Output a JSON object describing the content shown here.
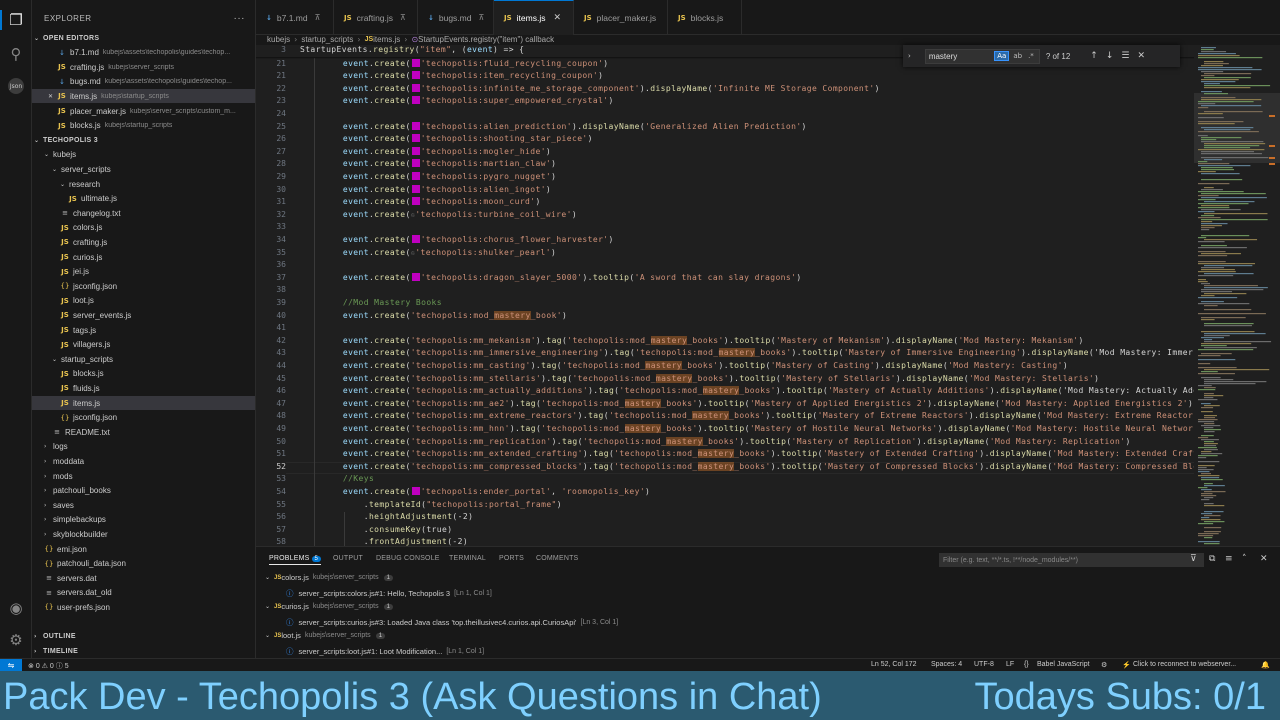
{
  "sidebar": {
    "title": "EXPLORER",
    "more": "···",
    "open_editors_label": "OPEN EDITORS",
    "open_editors": [
      {
        "icon": "md",
        "name": "b7.1.md",
        "path": "kubejs\\assets\\techopolis\\guides\\techop..."
      },
      {
        "icon": "js",
        "name": "crafting.js",
        "path": "kubejs\\server_scripts"
      },
      {
        "icon": "md",
        "name": "bugs.md",
        "path": "kubejs\\assets\\techopolis\\guides\\techop..."
      },
      {
        "icon": "js",
        "name": "items.js",
        "path": "kubejs\\startup_scripts"
      },
      {
        "icon": "js",
        "name": "placer_maker.js",
        "path": "kubejs\\server_scripts\\custom_m..."
      },
      {
        "icon": "js",
        "name": "blocks.js",
        "path": "kubejs\\startup_scripts"
      }
    ],
    "project_label": "TECHOPOLIS 3",
    "tree": [
      {
        "name": "kubejs",
        "kind": "folder-open",
        "indent": 1
      },
      {
        "name": "server_scripts",
        "kind": "folder-open",
        "indent": 2
      },
      {
        "name": "research",
        "kind": "folder-open",
        "indent": 3
      },
      {
        "name": "ultimate.js",
        "kind": "js",
        "indent": 4
      },
      {
        "name": "changelog.txt",
        "kind": "txt",
        "indent": 3
      },
      {
        "name": "colors.js",
        "kind": "js",
        "indent": 3
      },
      {
        "name": "crafting.js",
        "kind": "js",
        "indent": 3
      },
      {
        "name": "curios.js",
        "kind": "js",
        "indent": 3
      },
      {
        "name": "jei.js",
        "kind": "js",
        "indent": 3
      },
      {
        "name": "jsconfig.json",
        "kind": "json",
        "indent": 3
      },
      {
        "name": "loot.js",
        "kind": "js",
        "indent": 3
      },
      {
        "name": "server_events.js",
        "kind": "js",
        "indent": 3
      },
      {
        "name": "tags.js",
        "kind": "js",
        "indent": 3
      },
      {
        "name": "villagers.js",
        "kind": "js",
        "indent": 3
      },
      {
        "name": "startup_scripts",
        "kind": "folder-open",
        "indent": 2
      },
      {
        "name": "blocks.js",
        "kind": "js",
        "indent": 3
      },
      {
        "name": "fluids.js",
        "kind": "js",
        "indent": 3
      },
      {
        "name": "items.js",
        "kind": "js",
        "indent": 3
      },
      {
        "name": "jsconfig.json",
        "kind": "json",
        "indent": 3
      },
      {
        "name": "README.txt",
        "kind": "txt",
        "indent": 2
      },
      {
        "name": "logs",
        "kind": "folder",
        "indent": 1
      },
      {
        "name": "moddata",
        "kind": "folder",
        "indent": 1
      },
      {
        "name": "mods",
        "kind": "folder",
        "indent": 1
      },
      {
        "name": "patchouli_books",
        "kind": "folder",
        "indent": 1
      },
      {
        "name": "saves",
        "kind": "folder",
        "indent": 1
      },
      {
        "name": "simplebackups",
        "kind": "folder",
        "indent": 1
      },
      {
        "name": "skyblockbuilder",
        "kind": "folder",
        "indent": 1
      },
      {
        "name": "emi.json",
        "kind": "json",
        "indent": 1
      },
      {
        "name": "patchouli_data.json",
        "kind": "json",
        "indent": 1
      },
      {
        "name": "servers.dat",
        "kind": "dat",
        "indent": 1
      },
      {
        "name": "servers.dat_old",
        "kind": "dat",
        "indent": 1
      },
      {
        "name": "user-prefs.json",
        "kind": "json",
        "indent": 1
      }
    ],
    "outline_label": "OUTLINE",
    "timeline_label": "TIMELINE"
  },
  "tabs": [
    {
      "icon": "md",
      "label": "b7.1.md",
      "pin": true
    },
    {
      "icon": "js",
      "label": "crafting.js",
      "pin": true
    },
    {
      "icon": "md",
      "label": "bugs.md",
      "pin": true
    },
    {
      "icon": "js",
      "label": "items.js",
      "close": true,
      "active": true
    },
    {
      "icon": "js",
      "label": "placer_maker.js"
    },
    {
      "icon": "js",
      "label": "blocks.js"
    }
  ],
  "breadcrumb": [
    "kubejs",
    "startup_scripts",
    "items.js",
    "StartupEvents.registry(\"item\") callback"
  ],
  "find": {
    "query": "mastery",
    "opt_case": "Aa",
    "opt_word": "ab",
    "opt_regex": ".*",
    "count": "? of 12"
  },
  "editor": {
    "current_line": "52",
    "lines": [
      {
        "n": "3",
        "t": "StartupEvents.registry(\"item\", (event) => {",
        "k": "sticky"
      },
      {
        "n": "21",
        "t": "    event.create(  'techopolis:fluid_recycling_coupon')",
        "k": "sw"
      },
      {
        "n": "21",
        "t": "    event.create(  'techopolis:item_recycling_coupon')",
        "k": "sw"
      },
      {
        "n": "22",
        "t": "    event.create(  'techopolis:infinite_me_storage_component').displayName('Infinite ME Storage Component')",
        "k": "sw"
      },
      {
        "n": "23",
        "t": "    event.create(  'techopolis:super_empowered_crystal')",
        "k": "sw"
      },
      {
        "n": "24",
        "t": "",
        "k": "plain"
      },
      {
        "n": "25",
        "t": "    event.create(  'techopolis:alien_prediction').displayName('Generalized Alien Prediction')",
        "k": "sw"
      },
      {
        "n": "26",
        "t": "    event.create(  'techopolis:shooting_star_piece')",
        "k": "sw"
      },
      {
        "n": "27",
        "t": "    event.create(  'techopolis:mogler_hide')",
        "k": "sw"
      },
      {
        "n": "28",
        "t": "    event.create(  'techopolis:martian_claw')",
        "k": "sw"
      },
      {
        "n": "29",
        "t": "    event.create(  'techopolis:pygro_nugget')",
        "k": "sw"
      },
      {
        "n": "30",
        "t": "    event.create(  'techopolis:alien_ingot')",
        "k": "sw"
      },
      {
        "n": "31",
        "t": "    event.create(  'techopolis:moon_curd')",
        "k": "sw"
      },
      {
        "n": "32",
        "t": "    event.create(  'techopolis:turbine_coil_wire')",
        "k": "dim"
      },
      {
        "n": "33",
        "t": "",
        "k": "plain"
      },
      {
        "n": "34",
        "t": "    event.create(  'techopolis:chorus_flower_harvester')",
        "k": "sw"
      },
      {
        "n": "35",
        "t": "    event.create(  'techopolis:shulker_pearl')",
        "k": "dim"
      },
      {
        "n": "36",
        "t": "",
        "k": "plain"
      },
      {
        "n": "37",
        "t": "    event.create(  'techopolis:dragon_slayer_5000').tooltip('A sword that can slay dragons')",
        "k": "sw"
      },
      {
        "n": "38",
        "t": "",
        "k": "plain"
      },
      {
        "n": "39",
        "t": "    //Mod Mastery Books",
        "k": "com"
      },
      {
        "n": "40",
        "t": "    event.create('techopolis:mod_mastery_book')",
        "k": "plain"
      },
      {
        "n": "41",
        "t": "",
        "k": "plain"
      },
      {
        "n": "42",
        "t": "    event.create('techopolis:mm_mekanism').tag('techopolis:mod_mastery_books').tooltip('Mastery of Mekanism').displayName('Mod Mastery: Mekanism')",
        "k": "plain"
      },
      {
        "n": "43",
        "t": "    event.create('techopolis:mm_immersive_engineering').tag('techopolis:mod_mastery_books').tooltip('Mastery of Immersive Engineering').displayName('Mod Mastery: Immersive E",
        "k": "plain"
      },
      {
        "n": "44",
        "t": "    event.create('techopolis:mm_casting').tag('techopolis:mod_mastery_books').tooltip('Mastery of Casting').displayName('Mod Mastery: Casting')",
        "k": "plain"
      },
      {
        "n": "45",
        "t": "    event.create('techopolis:mm_stellaris').tag('techopolis:mod_mastery_books').tooltip('Mastery of Stellaris').displayName('Mod Mastery: Stellaris')",
        "k": "plain"
      },
      {
        "n": "46",
        "t": "    event.create('techopolis:mm_actually_additions').tag('techopolis:mod_mastery_books').tooltip('Mastery of Actually Additions').displayName('Mod Mastery: Actually Addition",
        "k": "plain"
      },
      {
        "n": "47",
        "t": "    event.create('techopolis:mm_ae2').tag('techopolis:mod_mastery_books').tooltip('Mastery of Applied Energistics 2').displayName('Mod Mastery: Applied Energistics 2')",
        "k": "plain"
      },
      {
        "n": "48",
        "t": "    event.create('techopolis:mm_extreme_reactors').tag('techopolis:mod_mastery_books').tooltip('Mastery of Extreme Reactors').displayName('Mod Mastery: Extreme Reactors')",
        "k": "plain"
      },
      {
        "n": "49",
        "t": "    event.create('techopolis:mm_hnn').tag('techopolis:mod_mastery_books').tooltip('Mastery of Hostile Neural Networks').displayName('Mod Mastery: Hostile Neural Networks')",
        "k": "plain"
      },
      {
        "n": "50",
        "t": "    event.create('techopolis:mm_replication').tag('techopolis:mod_mastery_books').tooltip('Mastery of Replication').displayName('Mod Mastery: Replication')",
        "k": "plain"
      },
      {
        "n": "51",
        "t": "    event.create('techopolis:mm_extended_crafting').tag('techopolis:mod_mastery_books').tooltip('Mastery of Extended Crafting').displayName('Mod Mastery: Extended Crafting')",
        "k": "plain"
      },
      {
        "n": "52",
        "t": "    event.create('techopolis:mm_compressed_blocks').tag('techopolis:mod_mastery_books').tooltip('Mastery of Compressed Blocks').displayName('Mod Mastery: Compressed Blocks')",
        "k": "plain"
      },
      {
        "n": "53",
        "t": "    //Keys",
        "k": "com"
      },
      {
        "n": "54",
        "t": "    event.create(  'techopolis:ender_portal', 'roomopolis_key')",
        "k": "sw"
      },
      {
        "n": "55",
        "t": "        .templateId(\"techopolis:portal_frame\")",
        "k": "plain"
      },
      {
        "n": "56",
        "t": "        .heightAdjustment(-2)",
        "k": "plain"
      },
      {
        "n": "57",
        "t": "        .consumeKey(true)",
        "k": "plain"
      },
      {
        "n": "58",
        "t": "        .frontAdjustment(-2)",
        "k": "plain"
      }
    ]
  },
  "panel": {
    "tabs": [
      {
        "label": "PROBLEMS",
        "badge": "5",
        "active": true
      },
      {
        "label": "OUTPUT"
      },
      {
        "label": "DEBUG CONSOLE"
      },
      {
        "label": "TERMINAL"
      },
      {
        "label": "PORTS"
      },
      {
        "label": "COMMENTS"
      }
    ],
    "filter_placeholder": "Filter (e.g. text, **/*.ts, !**/node_modules/**)",
    "groups": [
      {
        "file": "colors.js",
        "path": "kubejs\\server_scripts",
        "count": "1",
        "msg": "server_scripts:colors.js#1: Hello, Techopolis 3",
        "loc": "[Ln 1, Col 1]"
      },
      {
        "file": "curios.js",
        "path": "kubejs\\server_scripts",
        "count": "1",
        "msg": "server_scripts:curios.js#3: Loaded Java class 'top.theillusivec4.curios.api.CuriosApi'",
        "loc": "[Ln 3, Col 1]"
      },
      {
        "file": "loot.js",
        "path": "kubejs\\server_scripts",
        "count": "1",
        "msg": "server_scripts:loot.js#1: Loot Modification...",
        "loc": "[Ln 1, Col 1]"
      }
    ]
  },
  "status": {
    "errors": "0",
    "warnings": "0",
    "infos": "5",
    "position": "Ln 52, Col 172",
    "spaces": "Spaces: 4",
    "encoding": "UTF-8",
    "eol": "LF",
    "language": "Babel JavaScript",
    "remote": "Click to reconnect to webserver..."
  },
  "banner": {
    "left": "Pack Dev - Techopolis 3 (Ask Questions in Chat)",
    "right": "Todays Subs: 0/1"
  },
  "colors": {
    "accent": "#0078d4",
    "banner_bg": "#2b5a70",
    "banner_text": "#7fd0ff",
    "swatch": "#c000c0",
    "find_highlight": "#c86e28"
  }
}
